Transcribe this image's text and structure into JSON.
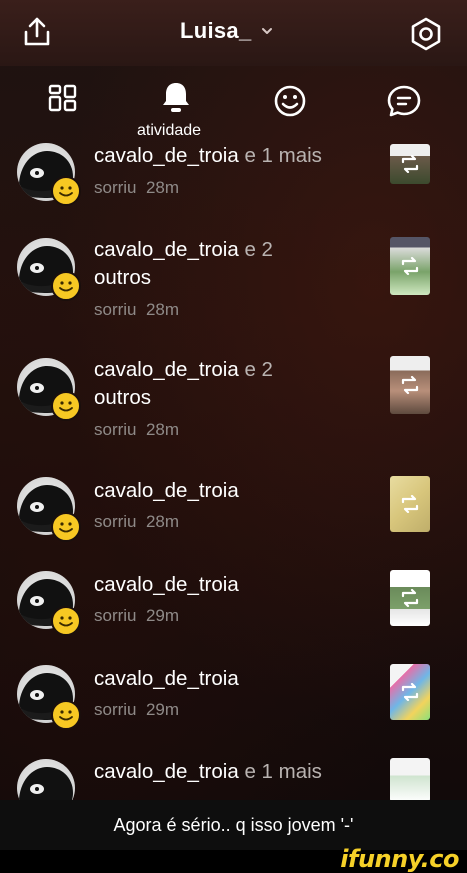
{
  "header": {
    "title": "Luisa_",
    "share_icon": "share-icon",
    "settings_icon": "settings-icon"
  },
  "tabs": {
    "items": [
      {
        "icon": "grid-icon"
      },
      {
        "icon": "bell-icon",
        "label": "atividade"
      },
      {
        "icon": "smiley-icon"
      },
      {
        "icon": "chat-icon"
      }
    ]
  },
  "notifications": [
    {
      "user": "cavalo_de_troia",
      "title_rest": " e 1 mais",
      "action": "sorriu",
      "time": "28m"
    },
    {
      "user": "cavalo_de_troia",
      "title_rest": " e 2",
      "title_line2": "outros",
      "action": "sorriu",
      "time": "28m"
    },
    {
      "user": "cavalo_de_troia",
      "title_rest": " e 2",
      "title_line2": "outros",
      "action": "sorriu",
      "time": "28m"
    },
    {
      "user": "cavalo_de_troia",
      "action": "sorriu",
      "time": "28m"
    },
    {
      "user": "cavalo_de_troia",
      "action": "sorriu",
      "time": "29m"
    },
    {
      "user": "cavalo_de_troia",
      "action": "sorriu",
      "time": "29m"
    },
    {
      "user": "cavalo_de_troia",
      "title_rest": " e 1 mais"
    }
  ],
  "caption": "Agora é sério.. q isso jovem '-'",
  "brand": "ifunny.co",
  "colors": {
    "accent_yellow": "#f7c823",
    "muted_text": "#8f8a88",
    "topbar": "#2a1714"
  }
}
